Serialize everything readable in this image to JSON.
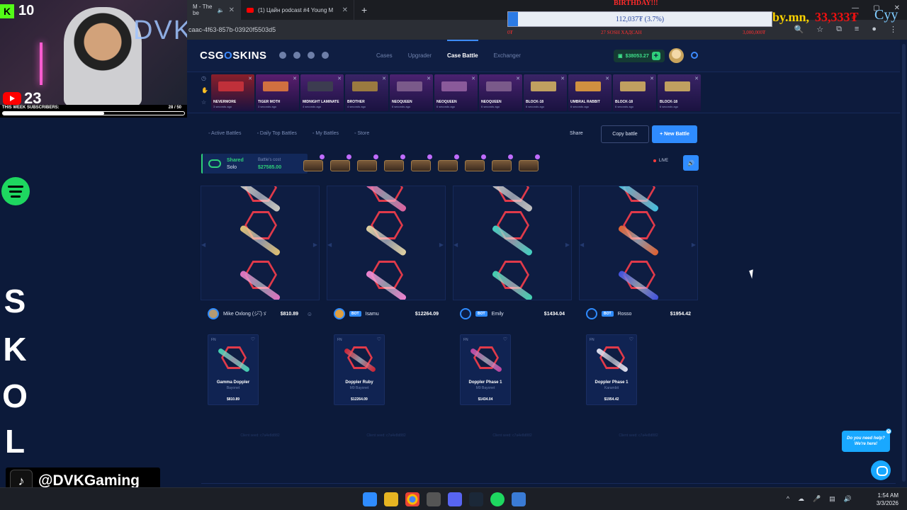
{
  "browser": {
    "tabs": [
      {
        "title": "M - The be",
        "active": true
      },
      {
        "title": "(1) Цайн podcast #4 Young M",
        "active": false
      }
    ],
    "url": "caac-4f63-857b-03920f5503d5"
  },
  "overlay": {
    "kick_count": "10",
    "youtube_count": "23",
    "subs_label": "THIS WEEK SUBSCRIBERS:",
    "subs_count": "28 / 50",
    "subs_progress": 0.56,
    "webcam_text": "DVK",
    "birthday": "BIRTHDAY!!!",
    "donation_bar": "112,037₮ (3.7%)",
    "donation_progress": 0.037,
    "donation_site": "by.mn,",
    "donation_amount": "33,333₮",
    "donation_cyy": "Cyy",
    "donation_mini": [
      "0₮",
      "27 SOSH ХАДСАН",
      "3,000,000₮"
    ],
    "logo_letters": [
      "S",
      "K",
      "O",
      "L"
    ],
    "tiktok_handle": "@DVKGaming"
  },
  "site": {
    "brand_a": "CSG",
    "brand_b": "O",
    "brand_c": "SKINS",
    "nav": [
      "Cases",
      "Upgrader",
      "Case Battle",
      "Exchanger"
    ],
    "nav_active": "Case Battle",
    "balance": "$38053.27",
    "live_drops": [
      {
        "name": "NEVERMORE",
        "time": "3 seconds ago",
        "color": "#8a1f2a",
        "gun": "#c0303a"
      },
      {
        "name": "TIGER MOTH",
        "time": "3 seconds ago",
        "color": "#5a1e6e",
        "gun": "#d07040"
      },
      {
        "name": "MIDNIGHT LAMINATE",
        "time": "4 seconds ago",
        "color": "#4a2270",
        "gun": "#3c3c50"
      },
      {
        "name": "BROTHER",
        "time": "4 seconds ago",
        "color": "#3a2466",
        "gun": "#9a7a40"
      },
      {
        "name": "NEOQUEEN",
        "time": "6 seconds ago",
        "color": "#4a2270",
        "gun": "#7a5a8a"
      },
      {
        "name": "NEOQUEEN",
        "time": "6 seconds ago",
        "color": "#4a2270",
        "gun": "#8a5a9a"
      },
      {
        "name": "NEOQUEEN",
        "time": "6 seconds ago",
        "color": "#4a2270",
        "gun": "#7a5a8a"
      },
      {
        "name": "BLOCK-18",
        "time": "6 seconds ago",
        "color": "#3a2466",
        "gun": "#c0a060"
      },
      {
        "name": "UMBRAL RABBIT",
        "time": "6 seconds ago",
        "color": "#3a2466",
        "gun": "#d09040"
      },
      {
        "name": "BLOCK-18",
        "time": "6 seconds ago",
        "color": "#3a2466",
        "gun": "#c0a060"
      },
      {
        "name": "BLOCK-18",
        "time": "6 seconds ago",
        "color": "#3a2466",
        "gun": "#c0a060"
      }
    ],
    "subnav": [
      "Active Battles",
      "Daily Top Battles",
      "My Battles",
      "Store"
    ],
    "share": "Share",
    "copy_battle": "Copy battle",
    "new_battle": "+ New Battle",
    "mode_a": "Shared",
    "mode_b": "Solo",
    "battle_cost_label": "Battle's cost",
    "battle_cost": "$27585.00",
    "case_count": 9,
    "live": "LIVE",
    "players": [
      {
        "name": "Mike Oxlong (シ゚-゚)ゞ",
        "bot": false,
        "value": "$810.89",
        "avatar": "#b59a72",
        "reel": [
          "#c9c9c0",
          "#e0c070",
          "#e070c0"
        ],
        "win": {
          "name": "Gamma Doppler",
          "type": "Bayonet",
          "price": "$810.89",
          "color": "#40d0b0"
        },
        "seed": "Client seed: c7a4e8d882"
      },
      {
        "name": "Isamu",
        "bot": true,
        "value": "$12264.09",
        "avatar": "#e0a040",
        "reel": [
          "#e060a0",
          "#e0d0a0",
          "#f080d0"
        ],
        "win": {
          "name": "Doppler Ruby",
          "type": "M9 Bayonet",
          "price": "$12264.09",
          "color": "#d02030"
        },
        "seed": "Client seed: c7a4e8d882"
      },
      {
        "name": "Emily",
        "bot": true,
        "value": "$1434.04",
        "avatar": "#0e1d42",
        "reel": [
          "#c0c0c0",
          "#40d0c0",
          "#40d0b0"
        ],
        "win": {
          "name": "Doppler Phase 1",
          "type": "M9 Bayonet",
          "price": "$1434.04",
          "color": "#c040a0"
        },
        "seed": "Client seed: c7a4e8d882"
      },
      {
        "name": "Rosso",
        "bot": true,
        "value": "$1954.42",
        "avatar": "#0e1d42",
        "reel": [
          "#40c0e0",
          "#e06030",
          "#4050e0"
        ],
        "win": {
          "name": "Doppler Phase 1",
          "type": "Karambit",
          "price": "$1954.42",
          "color": "#e0e0f0"
        },
        "seed": "Client seed: c7a4e8d882"
      }
    ],
    "chat_bubble": "Do you need help? We're here!"
  },
  "taskbar": {
    "time": "1:54 AM",
    "date": "3/3/2026"
  }
}
